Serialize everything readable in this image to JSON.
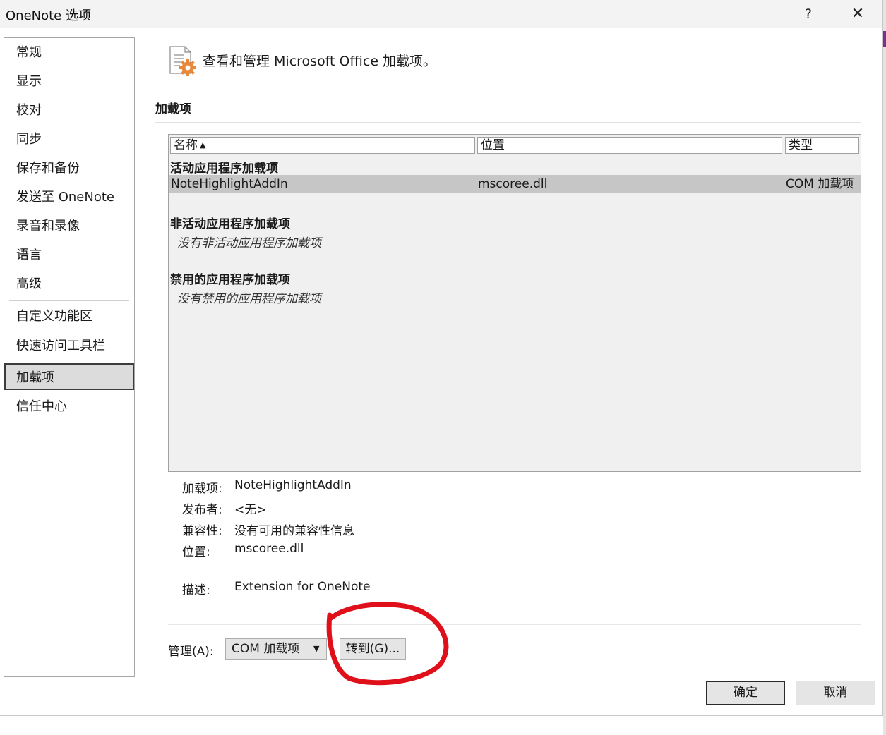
{
  "window": {
    "title": "OneNote 选项",
    "help_label": "?",
    "close_label": "✕"
  },
  "nav": {
    "items": [
      {
        "label": "常规"
      },
      {
        "label": "显示"
      },
      {
        "label": "校对"
      },
      {
        "label": "同步"
      },
      {
        "label": "保存和备份"
      },
      {
        "label": "发送至 OneNote"
      },
      {
        "label": "录音和录像"
      },
      {
        "label": "语言"
      },
      {
        "label": "高级"
      },
      {
        "label": "自定义功能区"
      },
      {
        "label": "快速访问工具栏"
      },
      {
        "label": "加载项"
      },
      {
        "label": "信任中心"
      }
    ],
    "selected": "加载项"
  },
  "header": {
    "text": "查看和管理 Microsoft Office 加载项。",
    "icon": "addin-gear-icon"
  },
  "section": {
    "title": "加载项"
  },
  "list": {
    "columns": {
      "name": "名称",
      "location": "位置",
      "type": "类型",
      "sort_indicator": "▲"
    },
    "active_group": "活动应用程序加载项",
    "active_row": {
      "name": "NoteHighlightAddIn",
      "location": "mscoree.dll",
      "type": "COM 加载项"
    },
    "inactive_group": "非活动应用程序加载项",
    "inactive_empty": "没有非活动应用程序加载项",
    "disabled_group": "禁用的应用程序加载项",
    "disabled_empty": "没有禁用的应用程序加载项"
  },
  "details": {
    "addin_label": "加载项:",
    "addin_value": "NoteHighlightAddIn",
    "publisher_label": "发布者:",
    "publisher_value": "<无>",
    "compat_label": "兼容性:",
    "compat_value": "没有可用的兼容性信息",
    "location_label": "位置:",
    "location_value": "mscoree.dll",
    "desc_label": "描述:",
    "desc_value": "Extension for OneNote"
  },
  "manage": {
    "label": "管理(A):",
    "selected": "COM 加载项",
    "arrow": "▼",
    "goto_label": "转到(G)..."
  },
  "buttons": {
    "ok": "确定",
    "cancel": "取消"
  },
  "colors": {
    "annotation": "#e0101b",
    "icon_accent": "#e8893a",
    "selected_row": "#c6c6c6"
  }
}
